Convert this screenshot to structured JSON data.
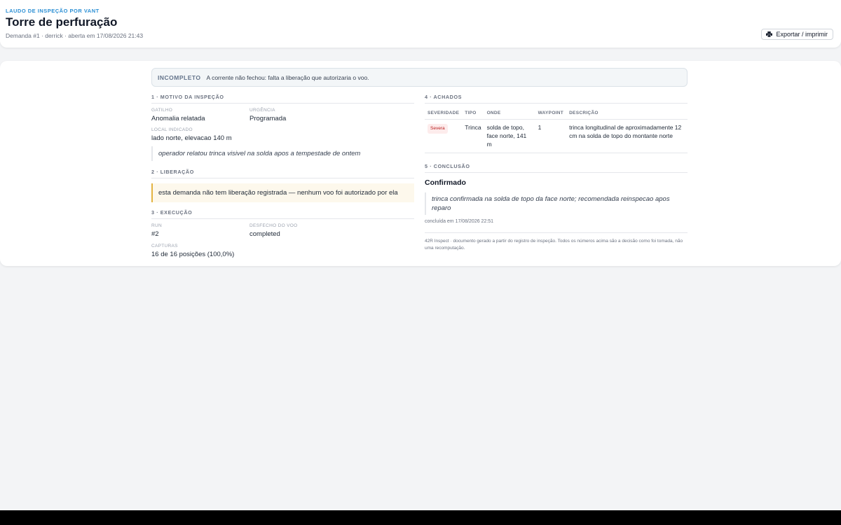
{
  "header": {
    "overline": "LAUDO DE INSPEÇÃO POR VANT",
    "title": "Torre de perfuração",
    "subtitle": "Demanda #1 · derrick · aberta em 17/08/2026 21:43",
    "export_label": "Exportar / imprimir"
  },
  "banner": {
    "status": "INCOMPLETO",
    "message": "A corrente não fechou: falta a liberação que autorizaria o voo."
  },
  "motivo": {
    "heading": "1 · MOTIVO DA INSPEÇÃO",
    "gatilho_label": "GATILHO",
    "gatilho_value": "Anomalia relatada",
    "urgencia_label": "URGÊNCIA",
    "urgencia_value": "Programada",
    "local_label": "LOCAL INDICADO",
    "local_value": "lado norte, elevacao 140 m",
    "quote": "operador relatou trinca visivel na solda apos a tempestade de ontem"
  },
  "liberacao": {
    "heading": "2 · LIBERAÇÃO",
    "warning": "esta demanda não tem liberação registrada — nenhum voo foi autorizado por ela"
  },
  "execucao": {
    "heading": "3 · EXECUÇÃO",
    "run_label": "RUN",
    "run_value": "#2",
    "desfecho_label": "DESFECHO DO VOO",
    "desfecho_value": "completed",
    "capturas_label": "CAPTURAS",
    "capturas_value": "16 de 16 posições (100,0%)"
  },
  "achados": {
    "heading": "4 · ACHADOS",
    "columns": [
      "SEVERIDADE",
      "TIPO",
      "ONDE",
      "WAYPOINT",
      "DESCRIÇÃO"
    ],
    "rows": [
      {
        "severidade": "Severa",
        "tipo": "Trinca",
        "onde": "solda de topo, face norte, 141 m",
        "waypoint": "1",
        "descricao": "trinca longitudinal de aproximadamente 12 cm na solda de topo do montante norte"
      }
    ]
  },
  "conclusao": {
    "heading": "5 · CONCLUSÃO",
    "verdict": "Confirmado",
    "quote": "trinca confirmada na solda de topo da face norte; recomendada reinspecao apos reparo",
    "meta": "concluída em 17/08/2026 22:51",
    "footer": "42R Inspect · documento gerado a partir do registro de inspeção. Todos os números acima são a decisão como foi tomada, não uma recomputação."
  },
  "colors": {
    "accent": "#2b8fd4",
    "severe_badge_bg": "#fdecec",
    "severe_badge_text": "#b91c1c",
    "warning_border": "#e3b341"
  },
  "icons": {
    "export": "printer-icon"
  }
}
